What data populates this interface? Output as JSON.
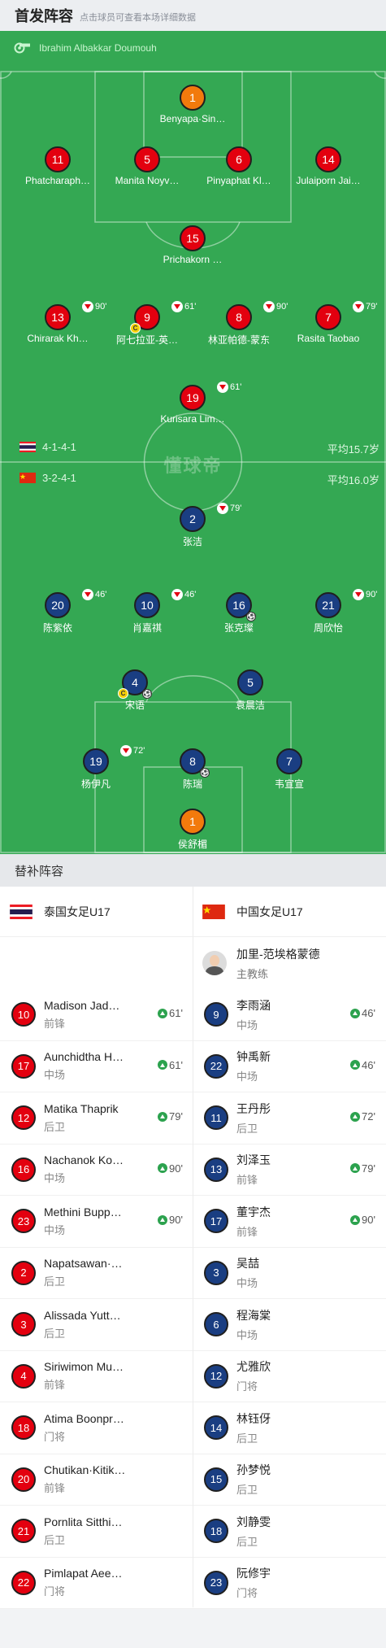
{
  "header": {
    "title": "首发阵容",
    "subtitle": "点击球员可查看本场详细数据"
  },
  "referee": "Ibrahim Albakkar Doumouh",
  "watermark": "懂球帝",
  "colors": {
    "pitch": "#34a853",
    "home_kit": "#e3000f",
    "goalkeeper_kit": "#f27a0c",
    "away_kit": "#1a3e82",
    "sub_in": "#2ca24e"
  },
  "home": {
    "formation": "4-1-4-1",
    "avg_age": "平均15.7岁",
    "flag": "thailand-flag",
    "players": [
      {
        "number": "1",
        "name": "Benyapa·Sin…",
        "gk": true,
        "sub": "",
        "captain": false,
        "goal": false
      },
      {
        "number": "11",
        "name": "Phatcharaph…",
        "gk": false,
        "sub": "",
        "captain": false,
        "goal": false
      },
      {
        "number": "5",
        "name": "Manita Noyv…",
        "gk": false,
        "sub": "",
        "captain": false,
        "goal": false
      },
      {
        "number": "6",
        "name": "Pinyaphat Kl…",
        "gk": false,
        "sub": "",
        "captain": false,
        "goal": false
      },
      {
        "number": "14",
        "name": "Julaiporn Jai…",
        "gk": false,
        "sub": "",
        "captain": false,
        "goal": false
      },
      {
        "number": "15",
        "name": "Prichakorn …",
        "gk": false,
        "sub": "",
        "captain": false,
        "goal": false
      },
      {
        "number": "13",
        "name": "Chirarak Kh…",
        "gk": false,
        "sub": "90'",
        "captain": false,
        "goal": false
      },
      {
        "number": "9",
        "name": "阿七拉亚-英…",
        "gk": false,
        "sub": "61'",
        "captain": true,
        "goal": false
      },
      {
        "number": "8",
        "name": "林亚帕德-蒙东",
        "gk": false,
        "sub": "90'",
        "captain": false,
        "goal": false
      },
      {
        "number": "7",
        "name": "Rasita Taobao",
        "gk": false,
        "sub": "79'",
        "captain": false,
        "goal": false
      },
      {
        "number": "19",
        "name": "Kurisara Lim…",
        "gk": false,
        "sub": "61'",
        "captain": false,
        "goal": false
      }
    ]
  },
  "away": {
    "formation": "3-2-4-1",
    "avg_age": "平均16.0岁",
    "flag": "china-flag",
    "players": [
      {
        "number": "2",
        "name": "张洁",
        "gk": false,
        "sub": "79'",
        "captain": false,
        "goal": false
      },
      {
        "number": "20",
        "name": "陈紫依",
        "gk": false,
        "sub": "46'",
        "captain": false,
        "goal": false
      },
      {
        "number": "10",
        "name": "肖嘉祺",
        "gk": false,
        "sub": "46'",
        "captain": false,
        "goal": false
      },
      {
        "number": "16",
        "name": "张克璨",
        "gk": false,
        "sub": "",
        "captain": false,
        "goal": true
      },
      {
        "number": "21",
        "name": "周欣怡",
        "gk": false,
        "sub": "90'",
        "captain": false,
        "goal": false
      },
      {
        "number": "4",
        "name": "宋语",
        "gk": false,
        "sub": "",
        "captain": true,
        "goal": true
      },
      {
        "number": "5",
        "name": "袁晨洁",
        "gk": false,
        "sub": "",
        "captain": false,
        "goal": false
      },
      {
        "number": "19",
        "name": "杨伊凡",
        "gk": false,
        "sub": "72'",
        "captain": false,
        "goal": false
      },
      {
        "number": "8",
        "name": "陈瑞",
        "gk": false,
        "sub": "",
        "captain": false,
        "goal": true
      },
      {
        "number": "7",
        "name": "韦宣宣",
        "gk": false,
        "sub": "",
        "captain": false,
        "goal": false
      },
      {
        "number": "1",
        "name": "侯舒楣",
        "gk": true,
        "sub": "",
        "captain": false,
        "goal": false
      }
    ]
  },
  "bench": {
    "title": "替补阵容",
    "home_team": "泰国女足U17",
    "away_team": "中国女足U17",
    "away_coach": {
      "name": "加里-范埃格蒙德",
      "role": "主教练"
    },
    "home_subs": [
      {
        "number": "10",
        "name": "Madison Jad…",
        "pos": "前锋",
        "in": "61'"
      },
      {
        "number": "17",
        "name": "Aunchidtha H…",
        "pos": "中场",
        "in": "61'"
      },
      {
        "number": "12",
        "name": "Matika Thaprik",
        "pos": "后卫",
        "in": "79'"
      },
      {
        "number": "16",
        "name": "Nachanok Ko…",
        "pos": "中场",
        "in": "90'"
      },
      {
        "number": "23",
        "name": "Methini Bupp…",
        "pos": "中场",
        "in": "90'"
      },
      {
        "number": "2",
        "name": "Napatsawan·…",
        "pos": "后卫",
        "in": ""
      },
      {
        "number": "3",
        "name": "Alissada Yutt…",
        "pos": "后卫",
        "in": ""
      },
      {
        "number": "4",
        "name": "Siriwimon Mu…",
        "pos": "前锋",
        "in": ""
      },
      {
        "number": "18",
        "name": "Atima Boonpr…",
        "pos": "门将",
        "in": ""
      },
      {
        "number": "20",
        "name": "Chutikan·Kitik…",
        "pos": "前锋",
        "in": ""
      },
      {
        "number": "21",
        "name": "Pornlita Sitthi…",
        "pos": "后卫",
        "in": ""
      },
      {
        "number": "22",
        "name": "Pimlapat Aee…",
        "pos": "门将",
        "in": ""
      }
    ],
    "away_subs": [
      {
        "number": "9",
        "name": "李雨涵",
        "pos": "中场",
        "in": "46'"
      },
      {
        "number": "22",
        "name": "钟禹新",
        "pos": "中场",
        "in": "46'"
      },
      {
        "number": "11",
        "name": "王丹彤",
        "pos": "后卫",
        "in": "72'"
      },
      {
        "number": "13",
        "name": "刘泽玉",
        "pos": "前锋",
        "in": "79'"
      },
      {
        "number": "17",
        "name": "董宇杰",
        "pos": "前锋",
        "in": "90'"
      },
      {
        "number": "3",
        "name": "吴喆",
        "pos": "中场",
        "in": ""
      },
      {
        "number": "6",
        "name": "程海棠",
        "pos": "中场",
        "in": ""
      },
      {
        "number": "12",
        "name": "尤雅欣",
        "pos": "门将",
        "in": ""
      },
      {
        "number": "14",
        "name": "林钰伢",
        "pos": "后卫",
        "in": ""
      },
      {
        "number": "15",
        "name": "孙梦悦",
        "pos": "后卫",
        "in": ""
      },
      {
        "number": "18",
        "name": "刘静雯",
        "pos": "后卫",
        "in": ""
      },
      {
        "number": "23",
        "name": "阮修宇",
        "pos": "门将",
        "in": ""
      }
    ]
  }
}
